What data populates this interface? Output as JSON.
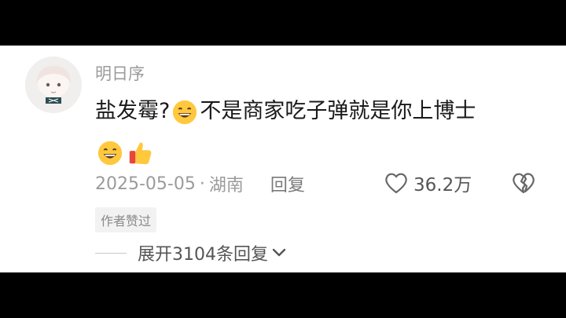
{
  "comment": {
    "username": "明日序",
    "text_part1": "盐发霉?",
    "text_part2": "不是商家吃子弹就是你上博士",
    "date": "2025-05-05",
    "separator": "·",
    "location": "湖南",
    "reply_label": "回复",
    "like_count": "36.2万",
    "author_badge": "作者赞过",
    "expand_label": "展开3104条回复"
  },
  "icons": [
    "grin-emoji-icon",
    "thumbs-up-emoji-icon",
    "heart-icon",
    "broken-heart-icon",
    "chevron-down-icon"
  ],
  "colors": {
    "muted": "#9b9b9b",
    "text": "#1a1a1a",
    "emoji": "#FFC83D"
  }
}
